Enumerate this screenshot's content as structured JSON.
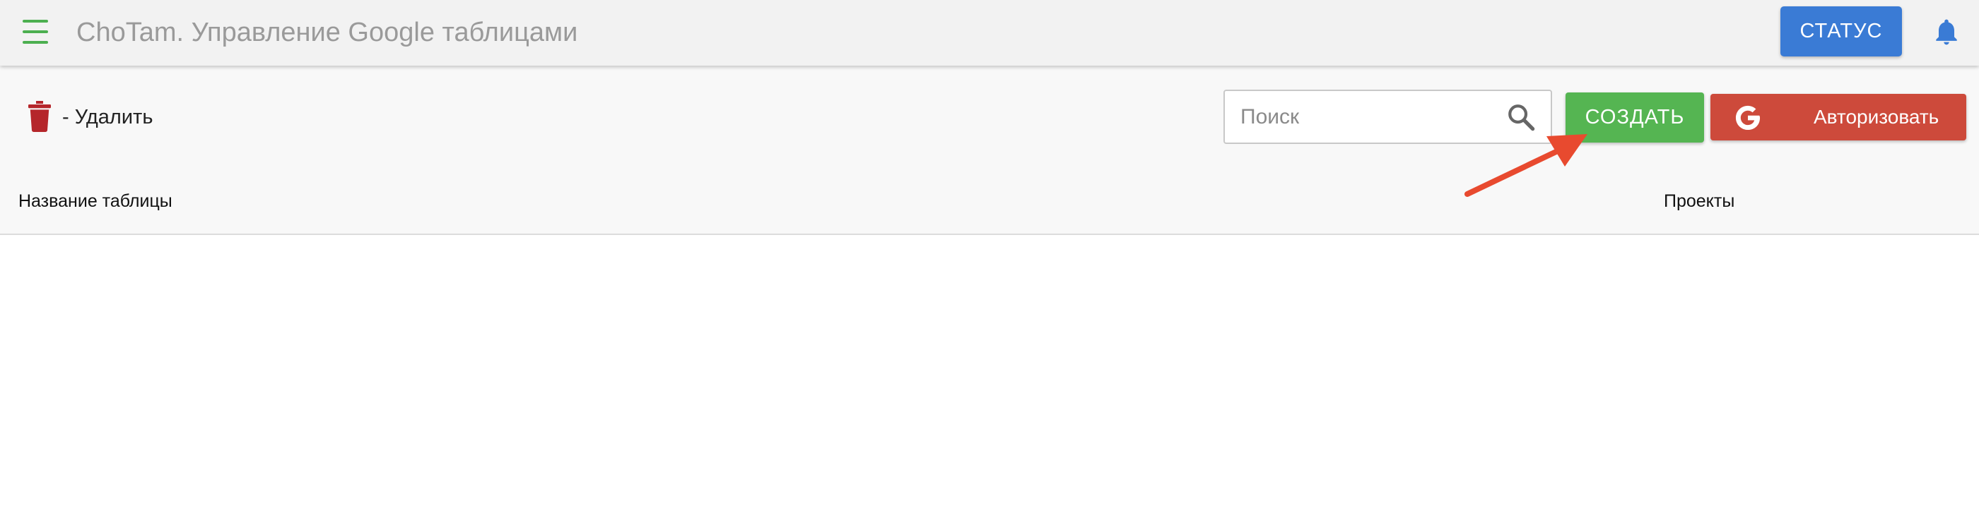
{
  "header": {
    "title": "ChoTam. Управление Google таблицами",
    "status_label": "СТАТУС",
    "menu_icon": "hamburger-menu-icon",
    "bell_icon": "bell-icon"
  },
  "toolbar": {
    "delete_legend": "- Удалить",
    "delete_icon": "trash-icon",
    "search_placeholder": "Поиск",
    "search_value": "",
    "create_label": "СОЗДАТЬ",
    "auth_label": "Авторизовать",
    "auth_icon": "google-g-icon"
  },
  "table": {
    "columns": [
      "Название таблицы",
      "Проекты"
    ],
    "rows": []
  },
  "colors": {
    "accent_green": "#4caf50",
    "status_blue": "#3a7bd5",
    "create_green": "#55b552",
    "auth_red": "#cd4a3b",
    "delete_red": "#b5262b",
    "annotation_arrow": "#e84a2f"
  }
}
